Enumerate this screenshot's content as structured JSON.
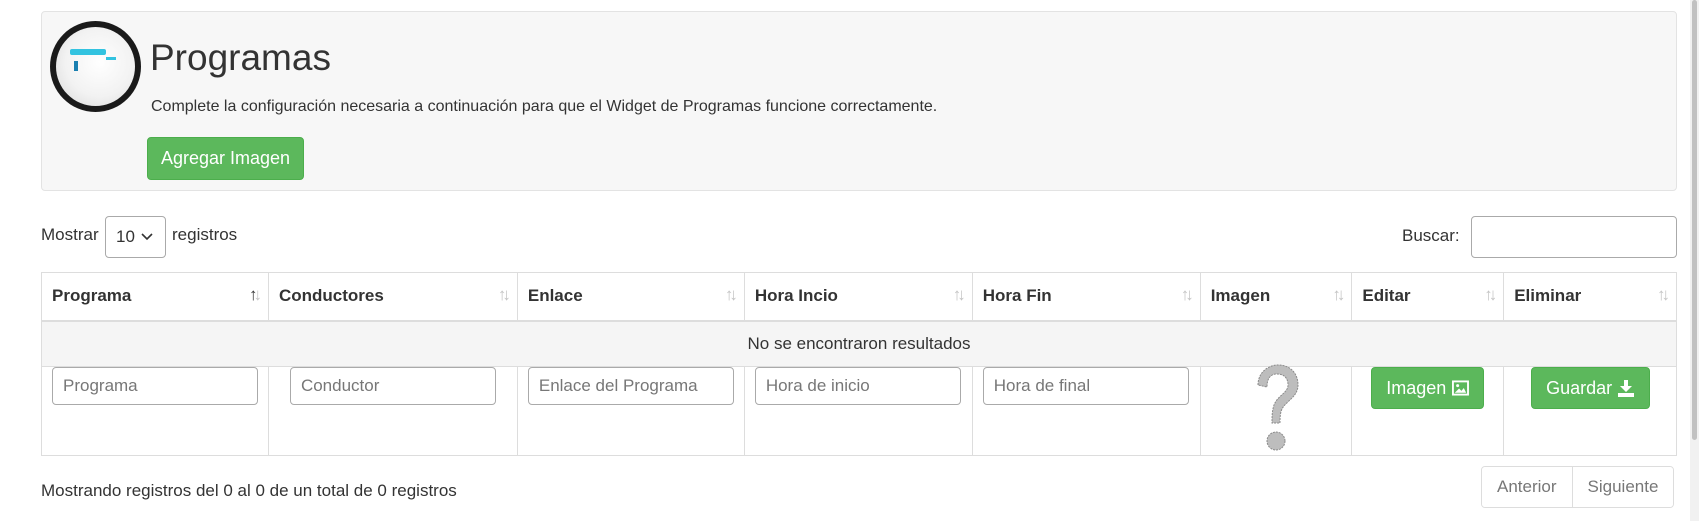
{
  "header": {
    "title": "Programas",
    "description": "Complete la configuración necesaria a continuación para que el Widget de Programas funcione correctamente.",
    "add_image_label": "Agregar Imagen"
  },
  "table_controls": {
    "show_label": "Mostrar",
    "page_length": "10",
    "records_label": "registros",
    "search_label": "Buscar:",
    "search_value": ""
  },
  "columns": [
    "Programa",
    "Conductores",
    "Enlace",
    "Hora Incio",
    "Hora Fin",
    "Imagen",
    "Editar",
    "Eliminar"
  ],
  "sort_icon": "sort-icon",
  "empty_message": "No se encontraron resultados",
  "input_row": {
    "programa_placeholder": "Programa",
    "conductor_placeholder": "Conductor",
    "enlace_placeholder": "Enlace del Programa",
    "hora_inicio_placeholder": "Hora de inicio",
    "hora_fin_placeholder": "Hora de final",
    "image_icon": "question-mark-icon",
    "imagen_button_label": "Imagen",
    "guardar_button_label": "Guardar"
  },
  "footer": {
    "info": "Mostrando registros del 0 al 0 de un total de 0 registros",
    "prev_label": "Anterior",
    "next_label": "Siguiente"
  },
  "colors": {
    "success": "#5cb85c",
    "panel_bg": "#f7f7f7",
    "border": "#dddddd"
  }
}
